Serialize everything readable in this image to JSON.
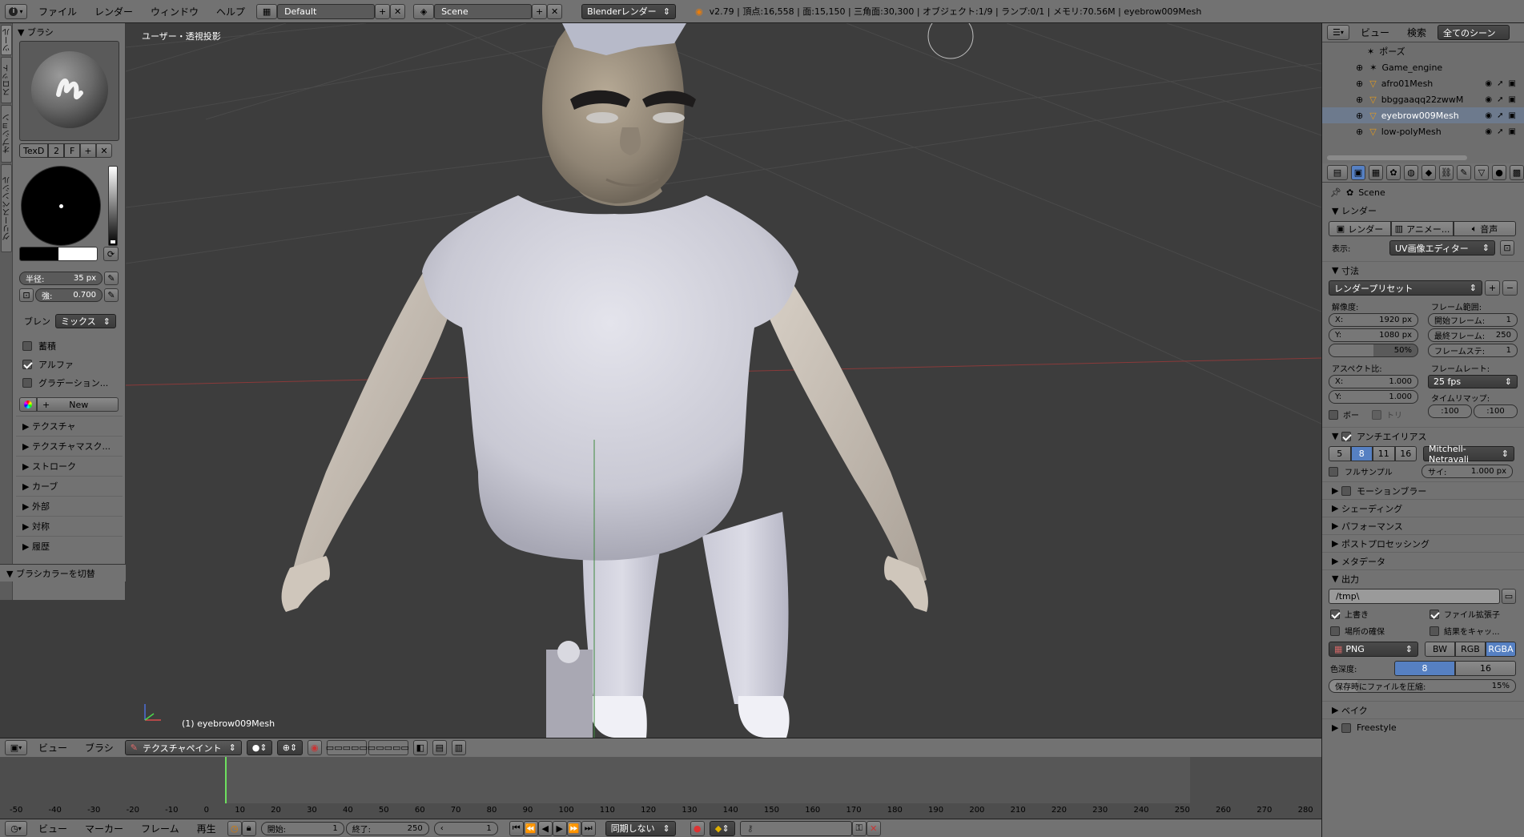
{
  "topbar": {
    "menus": [
      "ファイル",
      "レンダー",
      "ウィンドウ",
      "ヘルプ"
    ],
    "layout": "Default",
    "scene": "Scene",
    "engine": "Blenderレンダー",
    "stats": "v2.79 | 頂点:16,558 | 面:15,150 | 三角面:30,300 | オブジェクト:1/9 | ランプ:0/1 | メモリ:70.56M | eyebrow009Mesh"
  },
  "tabs": [
    "ツール",
    "スロット",
    "オプション",
    "グリースペンシル"
  ],
  "brush": {
    "title": "ブラシ",
    "tex_name": "TexD",
    "tex_users": "2",
    "tex_f": "F",
    "radius": "半径:",
    "radius_val": "35 px",
    "strength": "強:",
    "strength_val": "0.700",
    "blend_label": "ブレン",
    "blend_val": "ミックス",
    "checks": [
      {
        "label": "蓄積",
        "on": false
      },
      {
        "label": "アルファ",
        "on": true
      },
      {
        "label": "グラデーション...",
        "on": false
      }
    ],
    "new": "New"
  },
  "shelf_sections": [
    "テクスチャ",
    "テクスチャマスク...",
    "ストローク",
    "カーブ",
    "外部",
    "対称",
    "履歴"
  ],
  "swap_panel": "ブラシカラーを切替",
  "viewport": {
    "label": "ユーザー・透視投影",
    "object": "(1) eyebrow009Mesh"
  },
  "vheader": {
    "items": [
      "ビュー",
      "ブラシ"
    ],
    "mode": "テクスチャペイント"
  },
  "timeline": {
    "ticks": [
      "-50",
      "-40",
      "-30",
      "-20",
      "-10",
      "0",
      "10",
      "20",
      "30",
      "40",
      "50",
      "60",
      "70",
      "80",
      "90",
      "100",
      "110",
      "120",
      "130",
      "140",
      "150",
      "160",
      "170",
      "180",
      "190",
      "200",
      "210",
      "220",
      "230",
      "240",
      "250",
      "260",
      "270",
      "280"
    ],
    "current": "0"
  },
  "tlbar": {
    "menus": [
      "ビュー",
      "マーカー",
      "フレーム",
      "再生"
    ],
    "start": "開始:",
    "start_val": "1",
    "end": "終了:",
    "end_val": "250",
    "frame": "1",
    "sync": "同期しない"
  },
  "outliner": {
    "menus": [
      "ビュー",
      "検索"
    ],
    "filter": "全てのシーン",
    "items": [
      {
        "name": "ポーズ"
      },
      {
        "name": "Game_engine"
      },
      {
        "name": "afro01Mesh"
      },
      {
        "name": "bbggaaqq22zwwM"
      },
      {
        "name": "eyebrow009Mesh"
      },
      {
        "name": "low-polyMesh"
      }
    ]
  },
  "props": {
    "scene": "Scene",
    "render_title": "レンダー",
    "render_btns": [
      "レンダー",
      "アニメー...",
      "音声"
    ],
    "display_label": "表示:",
    "display_val": "UV画像エディター",
    "dims_title": "寸法",
    "preset": "レンダープリセット",
    "res_label": "解像度:",
    "res_x": "X:",
    "res_x_val": "1920 px",
    "res_y": "Y:",
    "res_y_val": "1080 px",
    "res_pct": "50%",
    "frange_label": "フレーム範囲:",
    "start": "開始フレーム:",
    "start_val": "1",
    "end": "最終フレーム:",
    "end_val": "250",
    "step": "フレームステ:",
    "step_val": "1",
    "aspect_label": "アスペクト比:",
    "asp_x": "X:",
    "asp_x_val": "1.000",
    "asp_y": "Y:",
    "asp_y_val": "1.000",
    "fps_label": "フレームレート:",
    "fps_val": "25 fps",
    "timemap_label": "タイムリマップ:",
    "timemap_old": ":100",
    "timemap_new": ":100",
    "border": "ボー",
    "crop": "トリ",
    "aa_title": "アンチエイリアス",
    "aa_samples": [
      "5",
      "8",
      "11",
      "16"
    ],
    "aa_filter": "Mitchell-Netravali",
    "fullsample": "フルサンプル",
    "size": "サイ:",
    "size_val": "1.000 px",
    "sections": [
      "モーションブラー",
      "シェーディング",
      "パフォーマンス",
      "ポストプロセッシング",
      "メタデータ"
    ],
    "output_title": "出力",
    "output_path": "/tmp\\",
    "overwrite": "上書き",
    "extensions": "ファイル拡張子",
    "placeholders": "場所の確保",
    "cache": "結果をキャッ...",
    "format": "PNG",
    "color_modes": [
      "BW",
      "RGB",
      "RGBA"
    ],
    "depth_label": "色深度:",
    "depth_vals": [
      "8",
      "16"
    ],
    "compression": "保存時にファイルを圧縮:",
    "compression_val": "15%",
    "bake": "ベイク",
    "freestyle": "Freestyle"
  }
}
